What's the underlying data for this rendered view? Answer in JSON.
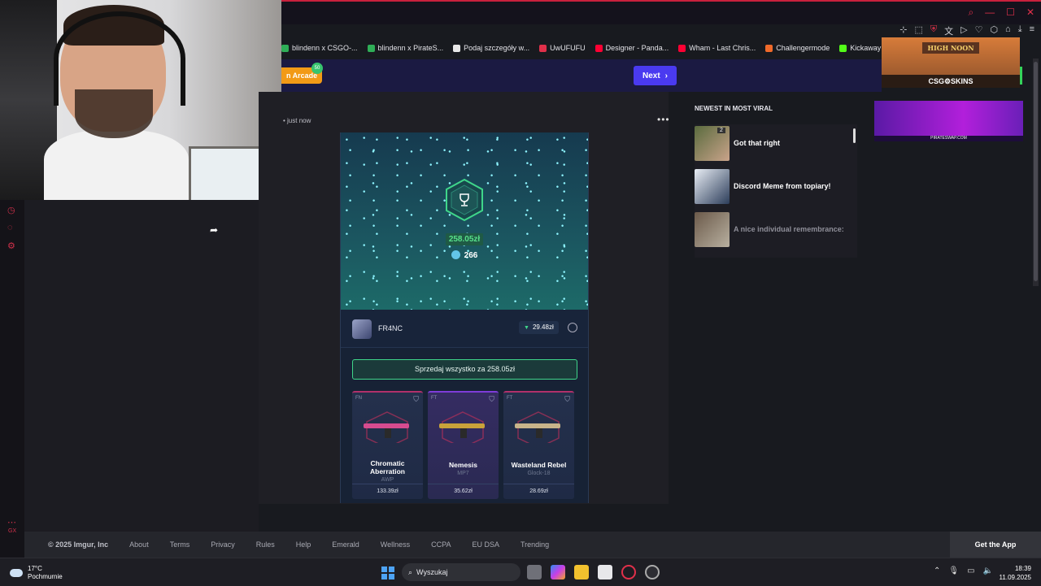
{
  "browser": {
    "bookmarks": [
      {
        "label": "blindenn x CSGO-...",
        "color": "#2fae57"
      },
      {
        "label": "blindenn x PirateS...",
        "color": "#2fae57"
      },
      {
        "label": "Podaj szczegóły w...",
        "color": "#e8e8e8"
      },
      {
        "label": "UwUFUFU",
        "color": "#e0304a"
      },
      {
        "label": "Designer - Panda...",
        "color": "#ff0033"
      },
      {
        "label": "Wham - Last Chris...",
        "color": "#ff0033"
      },
      {
        "label": "Challengermode",
        "color": "#f06a2a"
      },
      {
        "label": "Kickaway - Kick",
        "color": "#53fc18"
      }
    ]
  },
  "header": {
    "arcade_label": "n Arcade",
    "arcade_badge": "50",
    "next_label": "Next"
  },
  "post": {
    "timestamp": "• just now",
    "more": "•••",
    "case": {
      "total_price": "258.05zł",
      "coins": "266",
      "username": "FR4NC",
      "user_value": "29.48zł",
      "sell_all_label": "Sprzedaj wszystko za 258.05zł",
      "skins": [
        {
          "condition": "FN",
          "name": "Chromatic Aberration",
          "model": "AWP",
          "price": "133.39zł",
          "style": "red"
        },
        {
          "condition": "FT",
          "name": "Nemesis",
          "model": "MP7",
          "price": "35.62zł",
          "style": "purple"
        },
        {
          "condition": "FT",
          "name": "Wasteland Rebel",
          "model": "Glock-18",
          "price": "28.69zł",
          "style": "red"
        }
      ]
    }
  },
  "sidebar": {
    "newest_title": "NEWEST IN MOST VIRAL",
    "items": [
      {
        "title": "Got that right",
        "badge": "2",
        "dim": false
      },
      {
        "title": "Discord Meme from topiary!",
        "badge": "",
        "dim": false
      },
      {
        "title": "A nice individual remembrance:",
        "badge": "",
        "dim": true
      }
    ]
  },
  "ads": {
    "top_sign": "HIGH NOON",
    "top_brand": "CSG⚙SKINS",
    "mid_brand": "PIRATESWAP.COM"
  },
  "footer": {
    "copyright": "© 2025 Imgur, Inc",
    "links": [
      "About",
      "Terms",
      "Privacy",
      "Rules",
      "Help",
      "Emerald",
      "Wellness",
      "CCPA",
      "EU DSA",
      "Trending"
    ],
    "get_app": "Get the App"
  },
  "taskbar": {
    "temp": "17°C",
    "weather": "Pochmurnie",
    "search_placeholder": "Wyszukaj",
    "time": "18:39",
    "date": "11.09.2025"
  },
  "colors": {
    "accent": "#4a3af0",
    "brand_red": "#e0304a",
    "sell_green": "#3fd68a"
  }
}
